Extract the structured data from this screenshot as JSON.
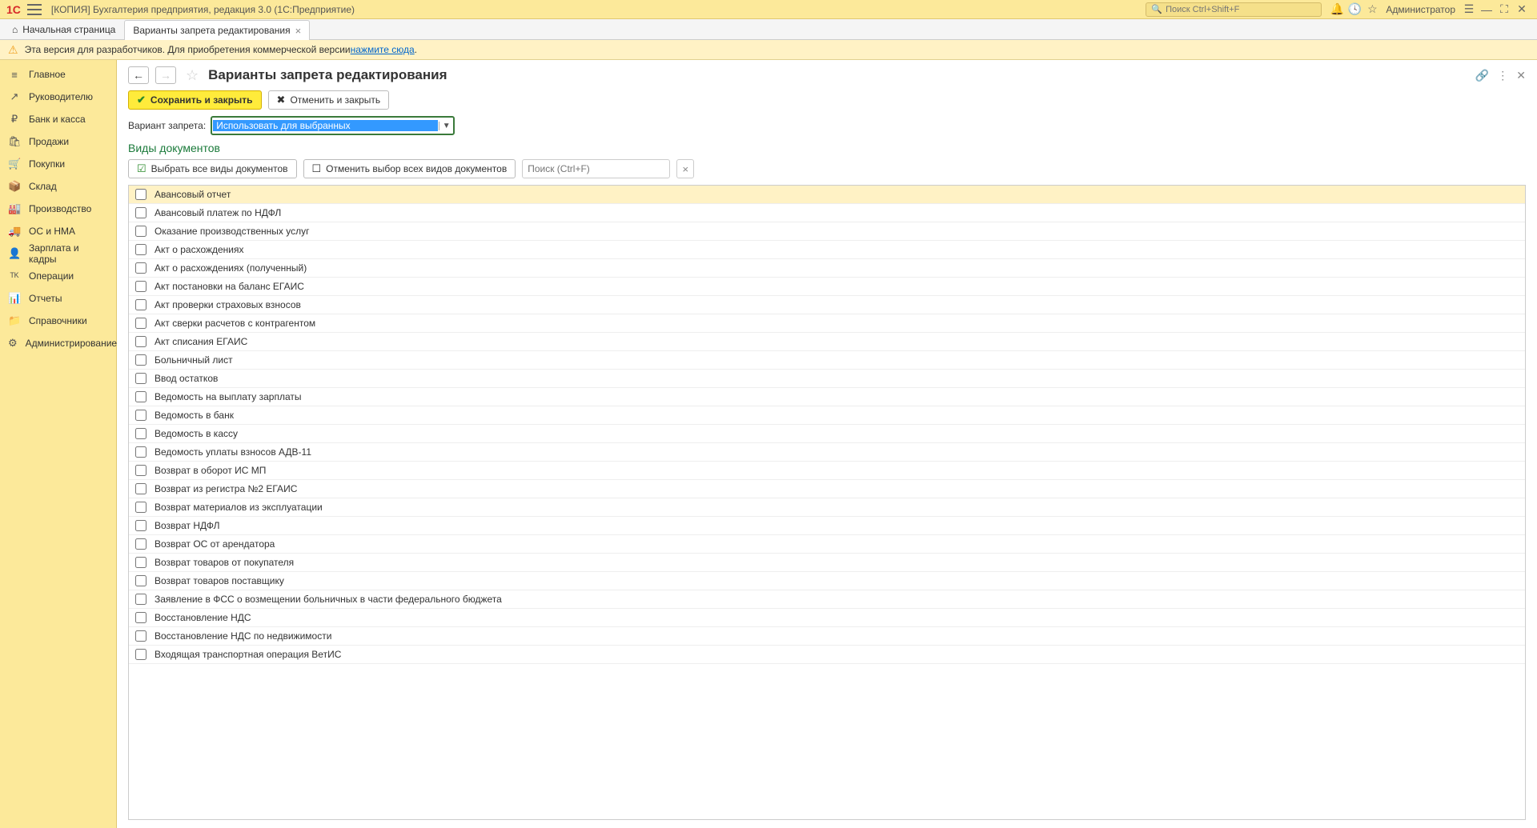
{
  "titlebar": {
    "logo": "1C",
    "title": "[КОПИЯ] Бухгалтерия предприятия, редакция 3.0  (1С:Предприятие)",
    "search_placeholder": "Поиск Ctrl+Shift+F",
    "user": "Администратор"
  },
  "tabs": [
    {
      "icon": "home",
      "label": "Начальная страница",
      "active": false,
      "closable": false
    },
    {
      "icon": "",
      "label": "Варианты запрета редактирования",
      "active": true,
      "closable": true
    }
  ],
  "warning": {
    "text": "Эта версия для разработчиков. Для приобретения коммерческой версии ",
    "link": "нажмите сюда",
    "suffix": "."
  },
  "sidebar": [
    {
      "icon": "≡",
      "label": "Главное"
    },
    {
      "icon": "↗",
      "label": "Руководителю"
    },
    {
      "icon": "₽",
      "label": "Банк и касса"
    },
    {
      "icon": "🛍",
      "label": "Продажи"
    },
    {
      "icon": "🛒",
      "label": "Покупки"
    },
    {
      "icon": "📦",
      "label": "Склад"
    },
    {
      "icon": "🏭",
      "label": "Производство"
    },
    {
      "icon": "🚚",
      "label": "ОС и НМА"
    },
    {
      "icon": "👤",
      "label": "Зарплата и кадры"
    },
    {
      "icon": "ᵀᴷ",
      "label": "Операции"
    },
    {
      "icon": "📊",
      "label": "Отчеты"
    },
    {
      "icon": "📁",
      "label": "Справочники"
    },
    {
      "icon": "⚙",
      "label": "Администрирование"
    }
  ],
  "page": {
    "title": "Варианты запрета редактирования",
    "save_close": "Сохранить и закрыть",
    "cancel_close": "Отменить и закрыть",
    "variant_label": "Вариант запрета:",
    "variant_value": "Использовать для выбранных",
    "section_title": "Виды документов",
    "select_all": "Выбрать все виды документов",
    "deselect_all": "Отменить выбор всех видов документов",
    "search_placeholder": "Поиск (Ctrl+F)"
  },
  "documents": [
    "Авансовый отчет",
    "Авансовый платеж по НДФЛ",
    "Оказание производственных услуг",
    "Акт о расхождениях",
    "Акт о расхождениях (полученный)",
    "Акт постановки на баланс ЕГАИС",
    "Акт проверки страховых взносов",
    "Акт сверки расчетов с контрагентом",
    "Акт списания ЕГАИС",
    "Больничный лист",
    "Ввод остатков",
    "Ведомость на выплату зарплаты",
    "Ведомость в банк",
    "Ведомость в кассу",
    "Ведомость уплаты взносов АДВ-11",
    "Возврат в оборот ИС МП",
    "Возврат из регистра №2 ЕГАИС",
    "Возврат материалов из эксплуатации",
    "Возврат НДФЛ",
    "Возврат ОС от арендатора",
    "Возврат товаров от покупателя",
    "Возврат товаров поставщику",
    "Заявление в ФСС о возмещении больничных в части федерального бюджета",
    "Восстановление НДС",
    "Восстановление НДС по недвижимости",
    "Входящая транспортная операция ВетИС"
  ]
}
